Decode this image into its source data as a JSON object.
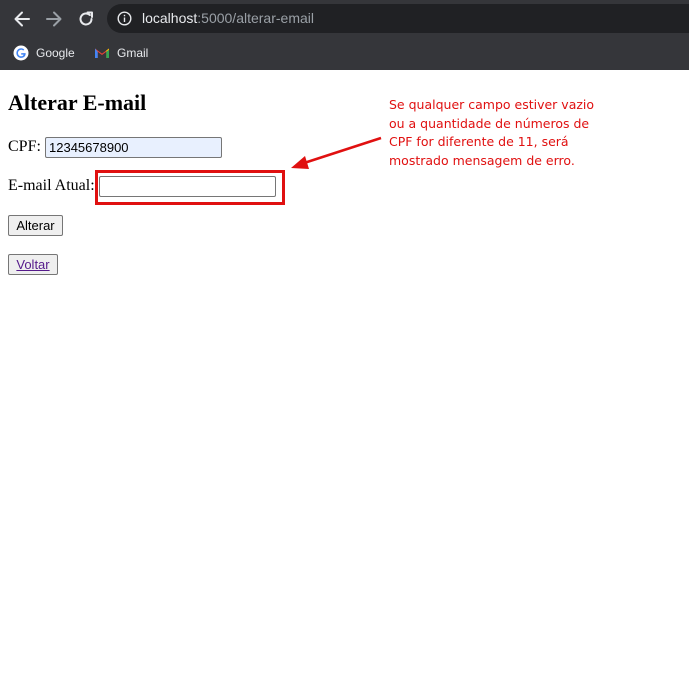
{
  "browser": {
    "url_host": "localhost",
    "url_path": ":5000/alterar-email",
    "bookmarks": [
      {
        "label": "Google"
      },
      {
        "label": "Gmail"
      }
    ]
  },
  "page": {
    "title": "Alterar E-mail",
    "cpf_label": "CPF:",
    "cpf_value": "12345678900",
    "email_label": "E-mail Atual:",
    "email_value": "",
    "submit_label": "Alterar",
    "back_label": "Voltar"
  },
  "annotation": {
    "lines": [
      "Se qualquer campo estiver vazio",
      "ou a quantidade de números de",
      "CPF for diferente de 11, será",
      "mostrado mensagem de erro."
    ],
    "color": "#e01010"
  }
}
